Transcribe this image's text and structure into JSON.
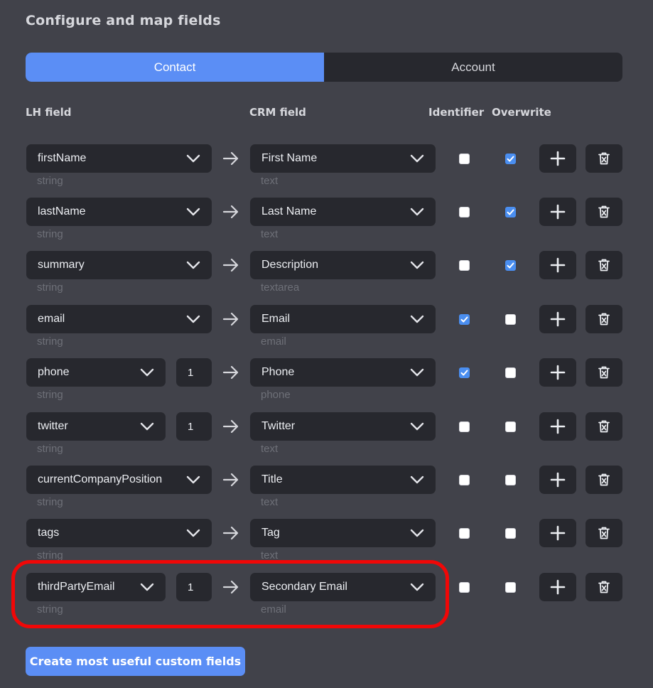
{
  "title": "Configure and map fields",
  "tabs": [
    {
      "label": "Contact",
      "active": true
    },
    {
      "label": "Account",
      "active": false
    }
  ],
  "columns": {
    "lh_field": "LH field",
    "crm_field": "CRM field",
    "identifier": "Identifier",
    "overwrite": "Overwrite"
  },
  "rows": [
    {
      "lh": "firstName",
      "lh_type": "string",
      "index": "",
      "crm": "First Name",
      "crm_type": "text",
      "identifier": false,
      "overwrite": true
    },
    {
      "lh": "lastName",
      "lh_type": "string",
      "index": "",
      "crm": "Last Name",
      "crm_type": "text",
      "identifier": false,
      "overwrite": true
    },
    {
      "lh": "summary",
      "lh_type": "string",
      "index": "",
      "crm": "Description",
      "crm_type": "textarea",
      "identifier": false,
      "overwrite": true
    },
    {
      "lh": "email",
      "lh_type": "string",
      "index": "",
      "crm": "Email",
      "crm_type": "email",
      "identifier": true,
      "overwrite": false
    },
    {
      "lh": "phone",
      "lh_type": "string",
      "index": "1",
      "crm": "Phone",
      "crm_type": "phone",
      "identifier": true,
      "overwrite": false
    },
    {
      "lh": "twitter",
      "lh_type": "string",
      "index": "1",
      "crm": "Twitter",
      "crm_type": "text",
      "identifier": false,
      "overwrite": false
    },
    {
      "lh": "currentCompanyPosition",
      "lh_type": "string",
      "index": "",
      "crm": "Title",
      "crm_type": "text",
      "identifier": false,
      "overwrite": false
    },
    {
      "lh": "tags",
      "lh_type": "string",
      "index": "",
      "crm": "Tag",
      "crm_type": "text",
      "identifier": false,
      "overwrite": false
    },
    {
      "lh": "thirdPartyEmail",
      "lh_type": "string",
      "index": "1",
      "crm": "Secondary Email",
      "crm_type": "email",
      "identifier": false,
      "overwrite": false
    }
  ],
  "icons": {
    "dropdown": "chevron-down-icon",
    "mapping": "arrow-right-icon",
    "add": "plus-icon",
    "delete": "trash-icon",
    "checked": "checkmark-icon"
  },
  "colors": {
    "accent": "#5b8ef5",
    "highlight": "#f10707",
    "background": "#41424a",
    "control": "#27282e"
  },
  "create_button": "Create most useful custom fields"
}
